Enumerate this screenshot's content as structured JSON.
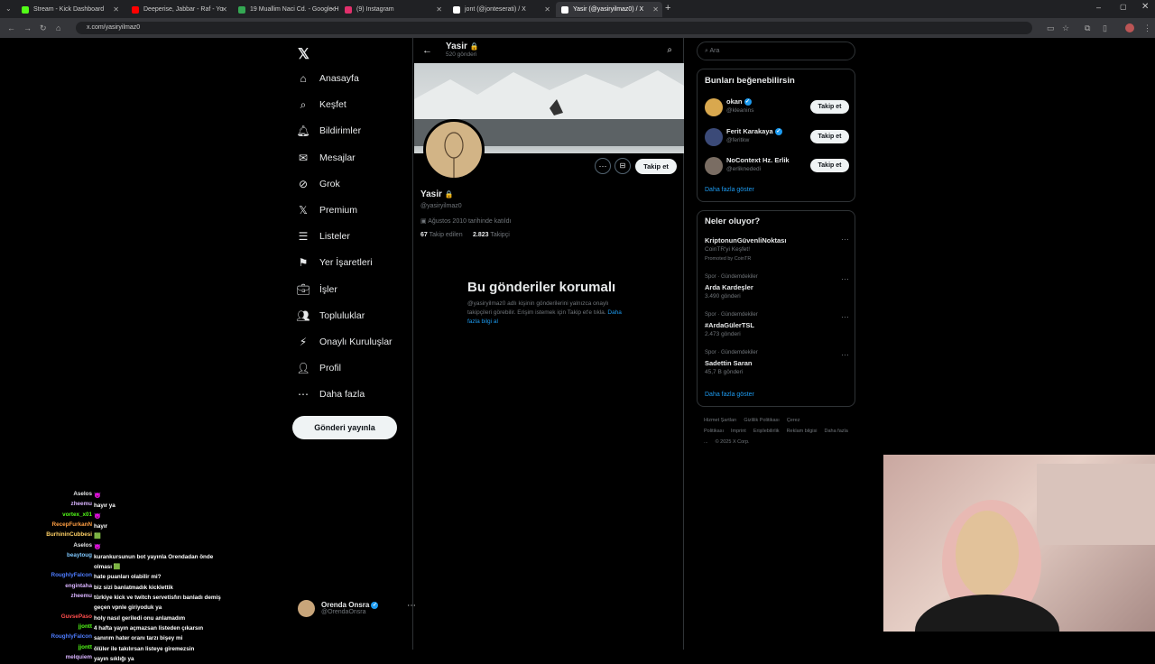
{
  "browser": {
    "tabs": [
      {
        "title": "Stream - Kick Dashboard",
        "color": "#53fc18"
      },
      {
        "title": "Deeperise, Jabbar - Raf - Yo",
        "color": "#ff0000"
      },
      {
        "title": "19 Muallim Naci Cd. - Google H",
        "color": "#34a853"
      },
      {
        "title": "(9) Instagram",
        "color": "#e1306c"
      },
      {
        "title": "jont (@jonteserati) / X",
        "color": "#ffffff"
      },
      {
        "title": "Yasir (@yasiryilmaz0) / X",
        "color": "#ffffff"
      }
    ],
    "url": "x.com/yasiryilmaz0"
  },
  "nav": {
    "items": [
      {
        "label": "Anasayfa",
        "icon": "home-icon"
      },
      {
        "label": "Keşfet",
        "icon": "search-icon"
      },
      {
        "label": "Bildirimler",
        "icon": "bell-icon"
      },
      {
        "label": "Mesajlar",
        "icon": "mail-icon"
      },
      {
        "label": "Grok",
        "icon": "grok-icon"
      },
      {
        "label": "Premium",
        "icon": "x-icon"
      },
      {
        "label": "Listeler",
        "icon": "list-icon"
      },
      {
        "label": "Yer İşaretleri",
        "icon": "bookmark-icon"
      },
      {
        "label": "İşler",
        "icon": "briefcase-icon"
      },
      {
        "label": "Topluluklar",
        "icon": "people-icon"
      },
      {
        "label": "Onaylı Kuruluşlar",
        "icon": "lightning-icon"
      },
      {
        "label": "Profil",
        "icon": "person-icon"
      },
      {
        "label": "Daha fazla",
        "icon": "more-circle-icon"
      }
    ],
    "post_button": "Gönderi yayınla",
    "account": {
      "name": "Orenda Onsra",
      "handle": "@OrendaOnsra"
    }
  },
  "profile": {
    "header_name": "Yasir",
    "header_posts": "520 gönderi",
    "name": "Yasir",
    "handle": "@yasiryilmaz0",
    "joined": "Ağustos 2010 tarihinde katıldı",
    "following_count": "67",
    "following_label": "Takip edilen",
    "followers_count": "2.823",
    "followers_label": "Takipçi",
    "follow_button": "Takip et",
    "protected_title": "Bu gönderiler korumalı",
    "protected_text": "@yasiryilmaz0 adlı kişinin gönderilerini yalnızca onaylı takipçileri görebilir. Erişim istemek için Takip et'e tıkla.",
    "protected_link": "Daha fazla bilgi al"
  },
  "right": {
    "search_placeholder": "Ara",
    "suggest_title": "Bunları beğenebilirsin",
    "suggestions": [
      {
        "name": "okan",
        "handle": "@kleanins",
        "button": "Takip et"
      },
      {
        "name": "Ferit Karakaya",
        "handle": "@feritkw",
        "button": "Takip et"
      },
      {
        "name": "NoContext Hz. Erlik",
        "handle": "@erliknededi",
        "button": "Takip et"
      }
    ],
    "show_more": "Daha fazla göster",
    "trends_title": "Neler oluyor?",
    "trends": [
      {
        "context": "",
        "title": "KriptonunGüvenliNoktası",
        "sub": "CoinTR'yi Keşfet!",
        "promo": "Promoted by CoinTR"
      },
      {
        "context": "Spor · Gündemdekiler",
        "title": "Arda Kardeşler",
        "sub": "3.490 gönderi",
        "promo": ""
      },
      {
        "context": "Spor · Gündemdekiler",
        "title": "#ArdaGülerTSL",
        "sub": "2.473 gönderi",
        "promo": ""
      },
      {
        "context": "Spor · Gündemdekiler",
        "title": "Sadettin Saran",
        "sub": "45,7 B gönderi",
        "promo": ""
      }
    ],
    "trends_more": "Daha fazla göster",
    "footer": [
      "Hizmet Şartları",
      "Gizlilik Politikası",
      "Çerez Politikası",
      "Imprint",
      "Erişilebilirlik",
      "Reklam bilgisi",
      "Daha fazla ...",
      "© 2025 X Corp."
    ]
  },
  "chat": [
    {
      "user": "Aselos",
      "color": "#e7e9ea",
      "msg": "👿"
    },
    {
      "user": "zheemu",
      "color": "#d9b3ff",
      "msg": "hayır ya"
    },
    {
      "user": "vortex_x01",
      "color": "#53fc18",
      "msg": "😈"
    },
    {
      "user": "RecepFurkanN",
      "color": "#ff9f43",
      "msg": "hayır"
    },
    {
      "user": "BurhininCubbesi",
      "color": "#ffd166",
      "msg": "🟩"
    },
    {
      "user": "Aselos",
      "color": "#e7e9ea",
      "msg": "👿"
    },
    {
      "user": "beaytoug",
      "color": "#7ec8ff",
      "msg": "kurankursunun bot yayınla Orendadan önde olması 🟩"
    },
    {
      "user": "RoughlyFalcon",
      "color": "#4d7cff",
      "msg": "hate puanları olabilir mi?"
    },
    {
      "user": "engintaha",
      "color": "#d9b3ff",
      "msg": "biz sizi banlatmadık kicklettik"
    },
    {
      "user": "zheemu",
      "color": "#d9b3ff",
      "msg": "türkiye kick ve twitch servetisfırı banladı demiş geçen vpnle giriyoduk ya"
    },
    {
      "user": "GuvsePaso",
      "color": "#ff4d4d",
      "msg": "holy nasıl geriledi onu anlamadım"
    },
    {
      "user": "jjontt",
      "color": "#53fc18",
      "msg": "4 hafta yayın açmazsan listeden çıkarsın"
    },
    {
      "user": "RoughlyFalcon",
      "color": "#4d7cff",
      "msg": "sanırım hater oranı tarzı bişey mi"
    },
    {
      "user": "jjontt",
      "color": "#53fc18",
      "msg": "ölüler ile takılırsan listeye giremezsin"
    },
    {
      "user": "melquiem",
      "color": "#d9b3ff",
      "msg": "yayın sıklığı ya"
    }
  ]
}
